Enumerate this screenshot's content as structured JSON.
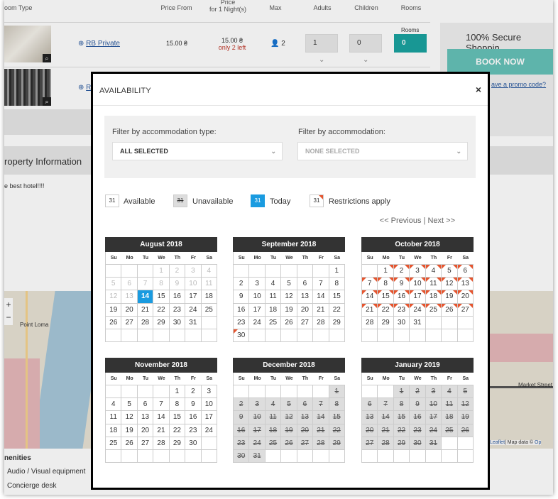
{
  "background": {
    "headers": {
      "room_type": "oom Type",
      "price_from": "Price From",
      "price_for": "Price\nfor 1 Night(s)",
      "max": "Max",
      "adults": "Adults",
      "children": "Children",
      "rooms": "Rooms"
    },
    "room1": {
      "name": "RB Private",
      "price_from": "15.00 ₴",
      "price": "15.00 ₴",
      "availability": "only 2 left",
      "max": "2",
      "adults": "1",
      "children": "0",
      "rooms": "0",
      "rooms_label": "Rooms"
    },
    "room2": {
      "name": "R"
    },
    "secure": "100% Secure Shoppin",
    "book_now": "BOOK NOW",
    "promo": "ave a promo code?",
    "property_info": "roperty Information",
    "description": "e best hotel!!!!",
    "map_labels": {
      "point_loma": "Point Loma",
      "market": "Market Street",
      "leaflet": "Leaflet",
      "map_data": "| Map data © ",
      "op": "Op"
    },
    "amenities": {
      "heading": "nenities",
      "items": [
        "Audio / Visual equipment",
        "Concierge desk"
      ]
    },
    "zoom": {
      "in": "+",
      "out": "−"
    }
  },
  "modal": {
    "title": "AVAILABILITY",
    "close": "×",
    "filter_type_label": "Filter by accommodation type:",
    "filter_type_value": "ALL SELECTED",
    "filter_acc_label": "Filter by accommodation:",
    "filter_acc_value": "NONE SELECTED",
    "legend": {
      "available": "Available",
      "unavailable": "Unavailable",
      "today": "Today",
      "restrictions": "Restrictions apply",
      "sample": "31"
    },
    "nav": {
      "prev": "<< Previous",
      "sep": " | ",
      "next": "Next >>"
    },
    "weekdays": [
      "Su",
      "Mo",
      "Tu",
      "We",
      "Th",
      "Fr",
      "Sa"
    ],
    "months": [
      {
        "title": "August 2018",
        "offset": 3,
        "days": 31,
        "past_until": 13,
        "today": 14
      },
      {
        "title": "September 2018",
        "offset": 6,
        "days": 30,
        "restrict_from": 30
      },
      {
        "title": "October 2018",
        "offset": 1,
        "days": 31,
        "restrict_range": [
          1,
          27
        ]
      },
      {
        "title": "November 2018",
        "offset": 4,
        "days": 30
      },
      {
        "title": "December 2018",
        "offset": 6,
        "days": 31,
        "unavailable_from": 1
      },
      {
        "title": "January 2019",
        "offset": 2,
        "days": 31,
        "unavailable_from": 1
      }
    ]
  },
  "colors": {
    "accent": "#1aa3a0",
    "today": "#1a9be0",
    "restriction": "#e5552f"
  }
}
